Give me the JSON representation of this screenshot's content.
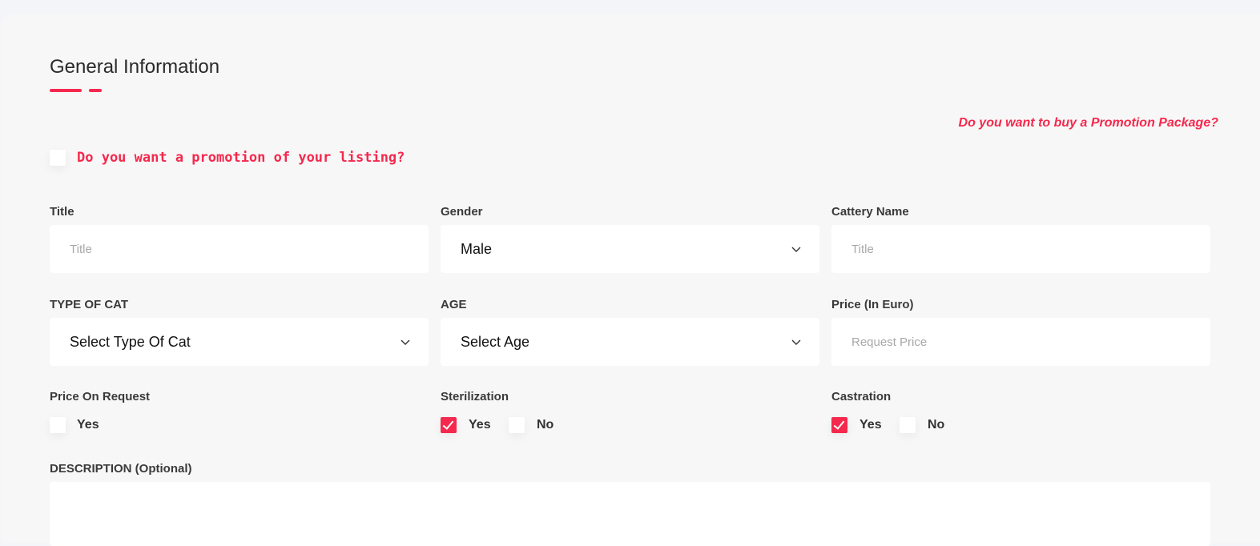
{
  "section": {
    "title": "General Information"
  },
  "promo": {
    "package_link": "Do you want to buy a Promotion Package?",
    "question": "Do you want a promotion of your listing?"
  },
  "fields": {
    "title": {
      "label": "Title",
      "placeholder": "Title"
    },
    "gender": {
      "label": "Gender",
      "value": "Male"
    },
    "cattery": {
      "label": "Cattery Name",
      "placeholder": "Title"
    },
    "type": {
      "label": "TYPE OF CAT",
      "value": "Select Type Of Cat"
    },
    "age": {
      "label": "AGE",
      "value": "Select Age"
    },
    "price": {
      "label": "Price (In Euro)",
      "placeholder": "Request Price"
    },
    "price_on_request": {
      "label": "Price On Request",
      "yes": "Yes"
    },
    "sterilization": {
      "label": "Sterilization",
      "yes": "Yes",
      "no": "No"
    },
    "castration": {
      "label": "Castration",
      "yes": "Yes",
      "no": "No"
    },
    "description": {
      "label": "DESCRIPTION (Optional)"
    }
  },
  "colors": {
    "accent": "#f5284d",
    "card_bg": "#f7f7f7",
    "field_bg": "#ffffff"
  },
  "icons": {
    "chevron": "chevron-down-icon",
    "check": "checkmark-icon"
  }
}
